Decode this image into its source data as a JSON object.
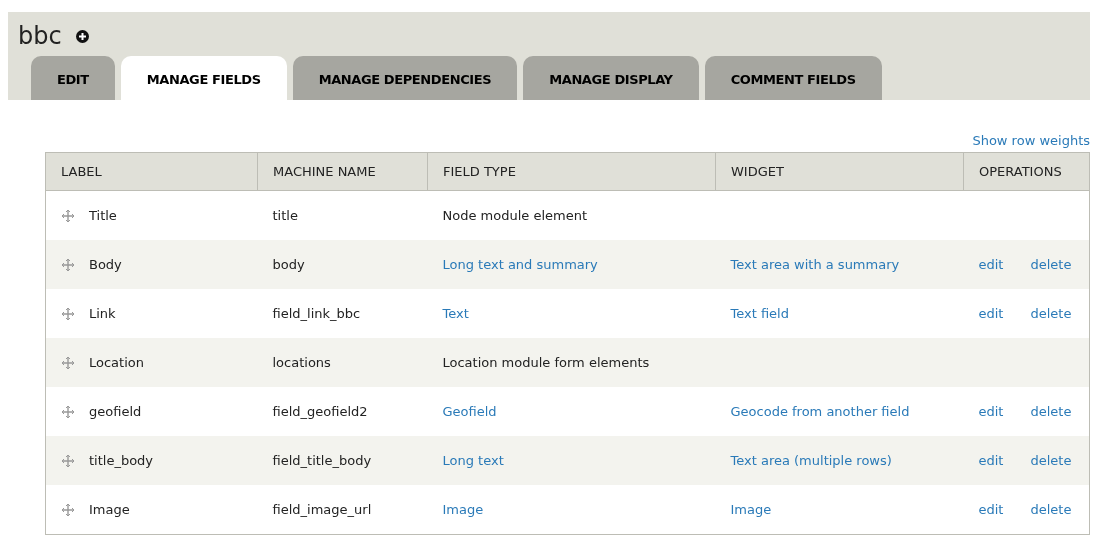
{
  "page_title": "bbc",
  "tabs": [
    {
      "label": "EDIT",
      "selected": false
    },
    {
      "label": "MANAGE FIELDS",
      "selected": true
    },
    {
      "label": "MANAGE DEPENDENCIES",
      "selected": false
    },
    {
      "label": "MANAGE DISPLAY",
      "selected": false
    },
    {
      "label": "COMMENT FIELDS",
      "selected": false
    }
  ],
  "show_row_weights_link": "Show row weights",
  "table": {
    "columns": [
      "LABEL",
      "MACHINE NAME",
      "FIELD TYPE",
      "WIDGET",
      "OPERATIONS"
    ],
    "rows": [
      {
        "label": "Title",
        "machine_name": "title",
        "field_type": {
          "text": "Node module element",
          "link": false
        },
        "operations": []
      },
      {
        "label": "Body",
        "machine_name": "body",
        "field_type": {
          "text": "Long text and summary",
          "link": true
        },
        "widget": {
          "text": "Text area with a summary",
          "link": true
        },
        "operations": [
          "edit",
          "delete"
        ]
      },
      {
        "label": "Link",
        "machine_name": "field_link_bbc",
        "field_type": {
          "text": "Text",
          "link": true
        },
        "widget": {
          "text": "Text field",
          "link": true
        },
        "operations": [
          "edit",
          "delete"
        ]
      },
      {
        "label": "Location",
        "machine_name": "locations",
        "field_type": {
          "text": "Location module form elements",
          "link": false
        },
        "operations": []
      },
      {
        "label": "geofield",
        "machine_name": "field_geofield2",
        "field_type": {
          "text": "Geofield",
          "link": true
        },
        "widget": {
          "text": "Geocode from another field",
          "link": true
        },
        "operations": [
          "edit",
          "delete"
        ]
      },
      {
        "label": "title_body",
        "machine_name": "field_title_body",
        "field_type": {
          "text": "Long text",
          "link": true
        },
        "widget": {
          "text": "Text area (multiple rows)",
          "link": true
        },
        "operations": [
          "edit",
          "delete"
        ]
      },
      {
        "label": "Image",
        "machine_name": "field_image_url",
        "field_type": {
          "text": "Image",
          "link": true
        },
        "widget": {
          "text": "Image",
          "link": true
        },
        "operations": [
          "edit",
          "delete"
        ]
      }
    ]
  }
}
